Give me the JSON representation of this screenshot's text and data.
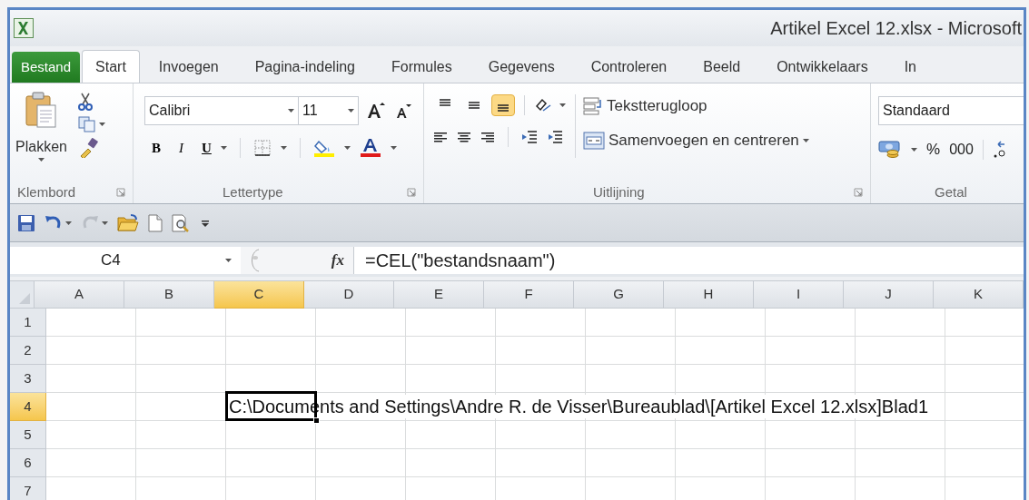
{
  "window": {
    "title": "Artikel Excel 12.xlsx  -  Microsoft"
  },
  "tabs": [
    {
      "label": "Bestand",
      "kind": "file",
      "selected": false
    },
    {
      "label": "Start",
      "kind": "tab",
      "selected": true
    },
    {
      "label": "Invoegen",
      "kind": "tab",
      "selected": false
    },
    {
      "label": "Pagina-indeling",
      "kind": "tab",
      "selected": false
    },
    {
      "label": "Formules",
      "kind": "tab",
      "selected": false
    },
    {
      "label": "Gegevens",
      "kind": "tab",
      "selected": false
    },
    {
      "label": "Controleren",
      "kind": "tab",
      "selected": false
    },
    {
      "label": "Beeld",
      "kind": "tab",
      "selected": false
    },
    {
      "label": "Ontwikkelaars",
      "kind": "tab",
      "selected": false
    },
    {
      "label": "In",
      "kind": "tab",
      "selected": false
    }
  ],
  "ribbon": {
    "clipboard": {
      "paste": "Plakken",
      "group": "Klembord"
    },
    "font": {
      "name": "Calibri",
      "size": "11",
      "bold": "B",
      "italic": "I",
      "underline": "U",
      "group": "Lettertype"
    },
    "alignment": {
      "vertical": [
        {
          "selected": false
        },
        {
          "selected": false
        },
        {
          "selected": true
        }
      ],
      "wrap": "Tekstterugloop",
      "merge": "Samenvoegen en centreren",
      "group": "Uitlijning"
    },
    "number": {
      "format": "Standaard",
      "percent": "%",
      "thousands": "000",
      "group": "Getal"
    }
  },
  "quick_access": {
    "redo_disabled": true
  },
  "formula_bar": {
    "name_box": "C4",
    "fx": "fx",
    "formula": "=CEL(\"bestandsnaam\")"
  },
  "sheet": {
    "columns": [
      {
        "label": "A",
        "selected": false
      },
      {
        "label": "B",
        "selected": false
      },
      {
        "label": "C",
        "selected": true
      },
      {
        "label": "D",
        "selected": false
      },
      {
        "label": "E",
        "selected": false
      },
      {
        "label": "F",
        "selected": false
      },
      {
        "label": "G",
        "selected": false
      },
      {
        "label": "H",
        "selected": false
      },
      {
        "label": "I",
        "selected": false
      },
      {
        "label": "J",
        "selected": false
      },
      {
        "label": "K",
        "selected": false
      }
    ],
    "rows": [
      {
        "label": "1",
        "selected": false
      },
      {
        "label": "2",
        "selected": false
      },
      {
        "label": "3",
        "selected": false
      },
      {
        "label": "4",
        "selected": true,
        "value": "C:\\Documents and Settings\\Andre R. de Visser\\Bureaublad\\[Artikel Excel 12.xlsx]Blad1"
      },
      {
        "label": "5",
        "selected": false
      },
      {
        "label": "6",
        "selected": false
      },
      {
        "label": "7",
        "selected": false
      }
    ]
  }
}
